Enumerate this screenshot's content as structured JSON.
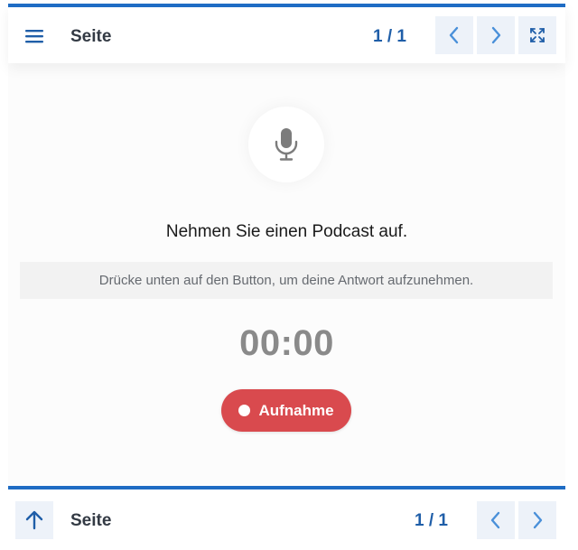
{
  "header": {
    "title": "Seite",
    "page_count": "1 / 1",
    "icons": {
      "menu": "hamburger-menu-icon",
      "prev": "chevron-left-icon",
      "next": "chevron-right-icon",
      "fullscreen": "expand-icon"
    }
  },
  "main": {
    "icon": "microphone-icon",
    "question": "Nehmen Sie einen Podcast auf.",
    "hint": "Drücke unten auf den Button, um deine Antwort aufzunehmen.",
    "timer": "00:00",
    "record_button_label": "Aufnahme"
  },
  "footer": {
    "title": "Seite",
    "page_count": "1 / 1",
    "icons": {
      "up": "arrow-up-icon",
      "prev": "chevron-left-icon",
      "next": "chevron-right-icon"
    }
  },
  "colors": {
    "accent": "#1f6cc4",
    "record": "#d94a4e",
    "nav_button_bg": "#edf2f9"
  }
}
